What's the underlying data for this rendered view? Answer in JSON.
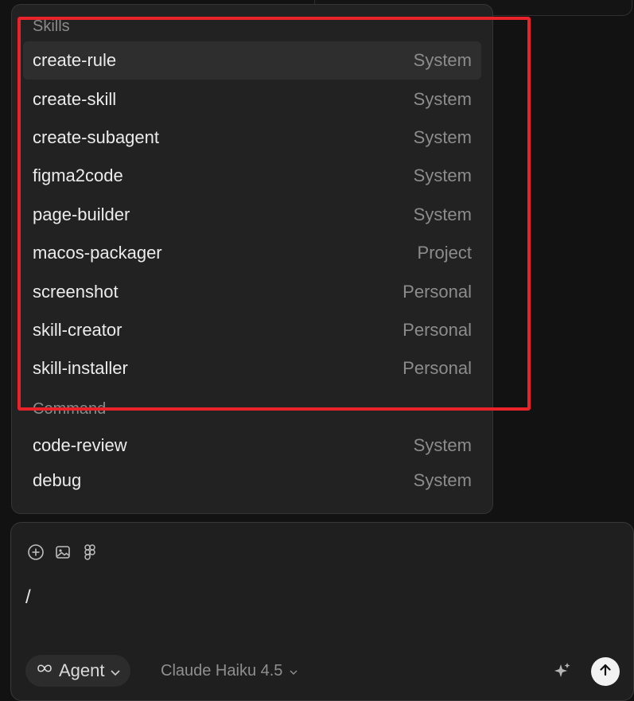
{
  "skills_section": {
    "title": "Skills",
    "items": [
      {
        "name": "create-rule",
        "source": "System"
      },
      {
        "name": "create-skill",
        "source": "System"
      },
      {
        "name": "create-subagent",
        "source": "System"
      },
      {
        "name": "figma2code",
        "source": "System"
      },
      {
        "name": "page-builder",
        "source": "System"
      },
      {
        "name": "macos-packager",
        "source": "Project"
      },
      {
        "name": "screenshot",
        "source": "Personal"
      },
      {
        "name": "skill-creator",
        "source": "Personal"
      },
      {
        "name": "skill-installer",
        "source": "Personal"
      }
    ]
  },
  "command_section": {
    "title": "Command",
    "items": [
      {
        "name": "code-review",
        "source": "System"
      },
      {
        "name": "debug",
        "source": "System"
      }
    ]
  },
  "composer": {
    "input_value": "/",
    "mode_label": "Agent",
    "model_label": "Claude Haiku 4.5",
    "icons": [
      "add-circle-icon",
      "image-icon",
      "figma-icon",
      "sparkle-icon",
      "arrow-up-icon"
    ]
  },
  "colors": {
    "highlight": "#e8232a",
    "popup_bg": "#222222",
    "active_row": "#2e2e2e"
  }
}
